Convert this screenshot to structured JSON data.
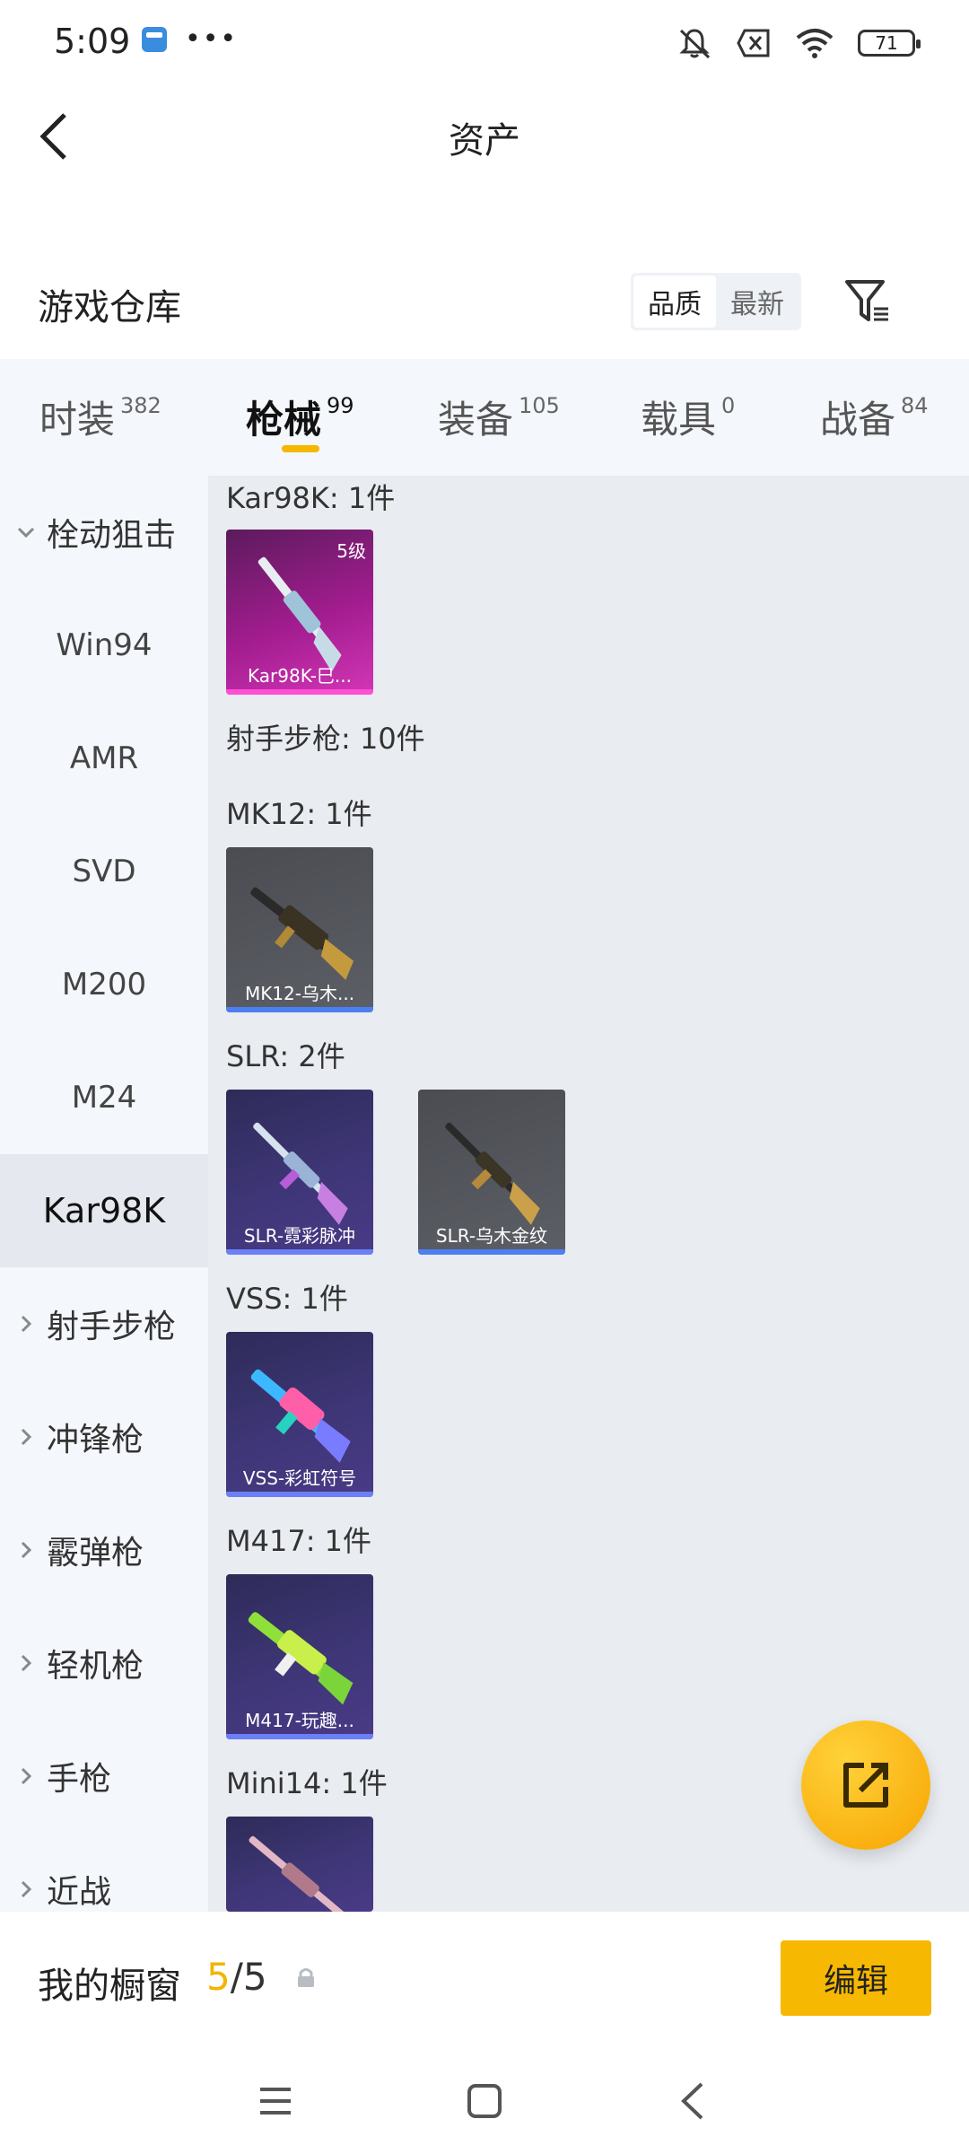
{
  "status_bar": {
    "time": "5:09",
    "battery": "71",
    "icons": [
      "app-notification-icon",
      "more-dots-icon",
      "mute-icon",
      "no-sim-icon",
      "wifi-icon",
      "battery-icon"
    ]
  },
  "header": {
    "title": "资产",
    "back_icon": "chevron-left-icon"
  },
  "warehouse": {
    "title": "游戏仓库",
    "sort_options": [
      "品质",
      "最新"
    ],
    "selected_sort": "品质",
    "filter_icon": "filter-icon"
  },
  "tabs": [
    {
      "label": "时装",
      "count": "382",
      "active": false
    },
    {
      "label": "枪械",
      "count": "99",
      "active": true
    },
    {
      "label": "装备",
      "count": "105",
      "active": false
    },
    {
      "label": "载具",
      "count": "0",
      "active": false
    },
    {
      "label": "战备",
      "count": "84",
      "active": false
    }
  ],
  "sidebar": {
    "expanded_group": "栓动狙击",
    "sub_items": [
      "Win94",
      "AMR",
      "SVD",
      "M200",
      "M24",
      "Kar98K"
    ],
    "selected_item": "Kar98K",
    "groups": [
      "射手步枪",
      "冲锋枪",
      "霰弹枪",
      "轻机枪",
      "手枪",
      "近战"
    ]
  },
  "content": {
    "sections": [
      {
        "label": "Kar98K: 1件"
      },
      {
        "label": "射手步枪: 10件"
      },
      {
        "label": "MK12: 1件"
      },
      {
        "label": "SLR: 2件"
      },
      {
        "label": "VSS: 1件"
      },
      {
        "label": "M417: 1件"
      },
      {
        "label": "Mini14: 1件"
      }
    ],
    "items": [
      {
        "name": "Kar98K-巳...",
        "badge": "5级",
        "rarity": "pink"
      },
      {
        "name": "MK12-乌木...",
        "rarity": "gray"
      },
      {
        "name": "SLR-霓彩脉冲",
        "rarity": "purple"
      },
      {
        "name": "SLR-乌木金纹",
        "rarity": "gray"
      },
      {
        "name": "VSS-彩虹符号",
        "rarity": "purple"
      },
      {
        "name": "M417-玩趣...",
        "rarity": "purple"
      },
      {
        "name": "",
        "rarity": "purple"
      }
    ]
  },
  "fab": {
    "icon": "share-external-icon"
  },
  "showcase": {
    "title": "我的橱窗",
    "current": "5",
    "separator": "/",
    "total": "5",
    "lock_icon": "lock-icon",
    "edit_label": "编辑"
  },
  "navbar": {
    "icons": [
      "menu-icon",
      "home-icon",
      "back-icon"
    ]
  },
  "colors": {
    "accent": "#f6b800",
    "sidebar_bg": "#f4f7fb",
    "content_bg": "#e9ecf1",
    "rarity_pink": "#d336b6",
    "rarity_purple": "#6b7ff7",
    "rarity_blue_bar": "#4d7ff0"
  }
}
